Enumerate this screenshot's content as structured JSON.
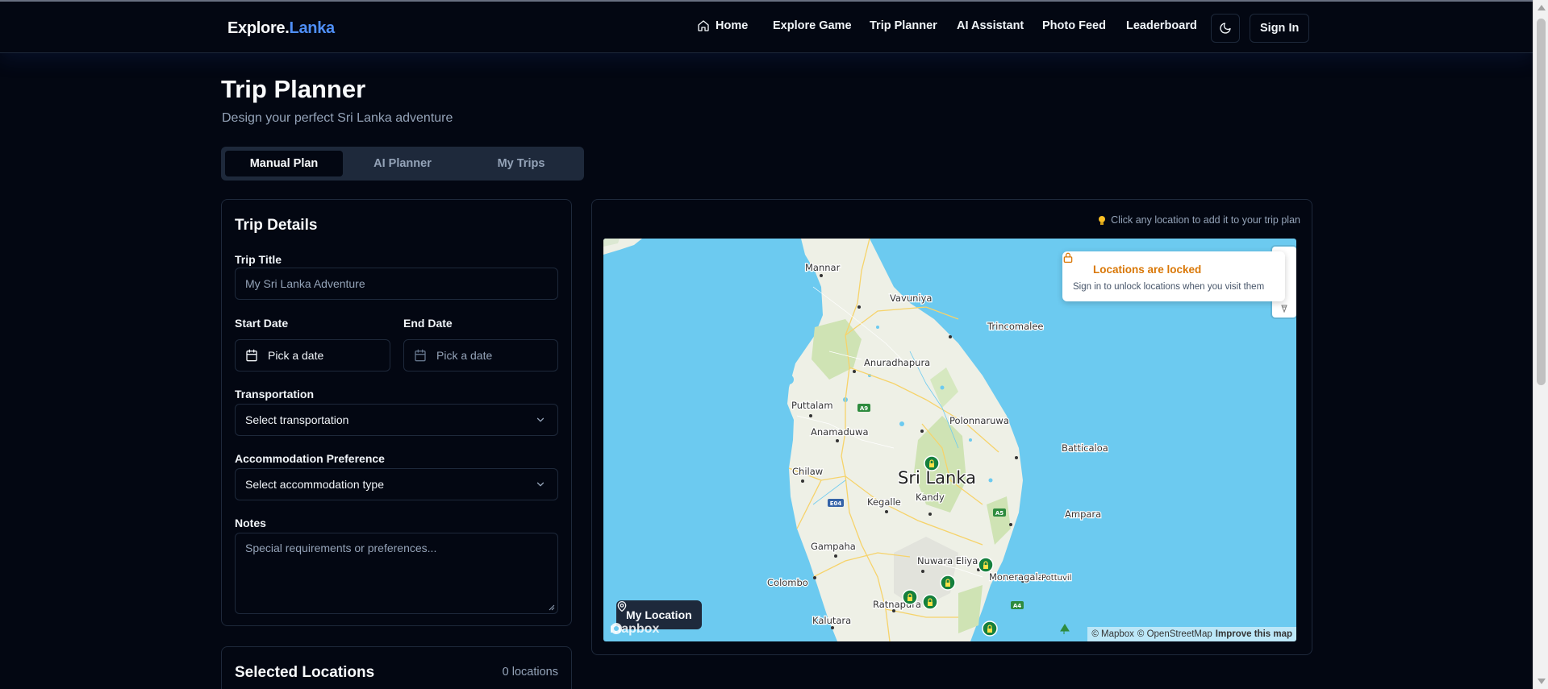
{
  "app": {
    "logo_main": "Explore.",
    "logo_accent": "Lanka",
    "accent_color": "#4f8ff7"
  },
  "nav": {
    "items": [
      {
        "label": "Home",
        "icon": "home-icon"
      },
      {
        "label": "Explore Game"
      },
      {
        "label": "Trip Planner"
      },
      {
        "label": "AI Assistant"
      },
      {
        "label": "Photo Feed"
      },
      {
        "label": "Leaderboard"
      }
    ],
    "theme_icon": "moon-icon",
    "signin_label": "Sign In"
  },
  "page": {
    "title": "Trip Planner",
    "subtitle": "Design your perfect Sri Lanka adventure"
  },
  "tabs": [
    {
      "label": "Manual Plan",
      "active": true
    },
    {
      "label": "AI Planner",
      "active": false
    },
    {
      "label": "My Trips",
      "active": false
    }
  ],
  "trip_details": {
    "title": "Trip Details",
    "trip_title_label": "Trip Title",
    "trip_title_placeholder": "My Sri Lanka Adventure",
    "start_date_label": "Start Date",
    "start_date_value": "Pick a date",
    "end_date_label": "End Date",
    "end_date_value": "Pick a date",
    "transport_label": "Transportation",
    "transport_value": "Select transportation",
    "accommodation_label": "Accommodation Preference",
    "accommodation_value": "Select accommodation type",
    "notes_label": "Notes",
    "notes_placeholder": "Special requirements or preferences..."
  },
  "selected_locations": {
    "title": "Selected Locations",
    "count": "0 locations"
  },
  "map": {
    "hint": "Click any location to add it to your trip plan",
    "hint_icon": "lightbulb-icon",
    "locked_title": "Locations are locked",
    "locked_text": "Sign in to unlock locations when you visit them",
    "my_location_label": "My Location",
    "attribution_1": "© Mapbox",
    "attribution_2": "© OpenStreetMap",
    "attribution_3": "Improve this map",
    "brand": "mapbox",
    "country_label": "Sri Lanka",
    "places": [
      {
        "name": "Mannar"
      },
      {
        "name": "Vavuniya"
      },
      {
        "name": "Trincomalee"
      },
      {
        "name": "Anuradhapura"
      },
      {
        "name": "Puttalam"
      },
      {
        "name": "Polonnaruwa"
      },
      {
        "name": "Anamaduwa"
      },
      {
        "name": "Batticaloa"
      },
      {
        "name": "Chilaw"
      },
      {
        "name": "Kegalle"
      },
      {
        "name": "Kandy"
      },
      {
        "name": "Ampara"
      },
      {
        "name": "Gampaha"
      },
      {
        "name": "Nuwara Eliya"
      },
      {
        "name": "Moneragala"
      },
      {
        "name": "Colombo"
      },
      {
        "name": "Pottuvil"
      },
      {
        "name": "Ratnapura"
      },
      {
        "name": "Kalutara"
      }
    ],
    "road_shields": [
      "A9",
      "E04",
      "A5",
      "A4"
    ]
  }
}
